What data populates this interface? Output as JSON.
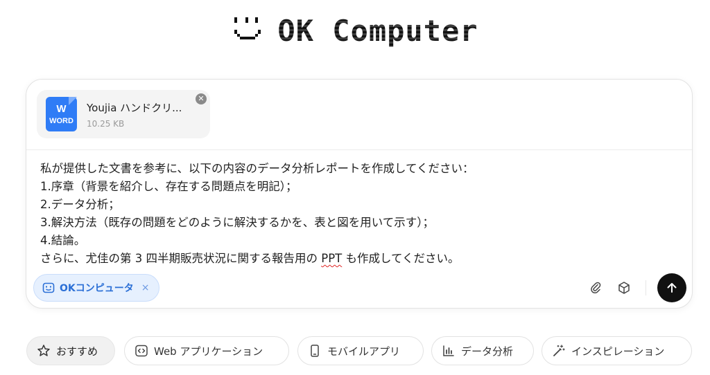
{
  "logo": {
    "text": "OK Computer"
  },
  "attachment": {
    "name": "Youjia ハンドクリ...",
    "size": "10.25 KB",
    "icon_label_top": "W",
    "icon_label_bottom": "WORD",
    "icon": "word-doc-icon",
    "close_icon": "close-icon"
  },
  "prompt": {
    "lines": [
      "私が提供した文書を参考に、以下の内容のデータ分析レポートを作成してください：",
      "1.序章（背景を紹介し、存在する問題点を明記）；",
      "2.データ分析；",
      "3.解決方法（既存の問題をどのように解決するかを、表と図を用いて示す）；",
      "4.結論。"
    ],
    "last_line_before": "さらに、尤佳の第 3 四半期販売状況に関する報告用の ",
    "last_line_misspelled": "PPT",
    "last_line_after": " も作成してください。"
  },
  "mode_chip": {
    "label": "OKコンピュータ",
    "close": "×",
    "icon": "robot-face-icon"
  },
  "toolbar": {
    "attach_icon": "paperclip-icon",
    "cube_icon": "cube-icon",
    "send_icon": "arrow-up-icon"
  },
  "suggestions": [
    {
      "label": "おすすめ",
      "icon": "star-icon",
      "active": true
    },
    {
      "label": "Web アプリケーション",
      "icon": "code-icon",
      "active": false
    },
    {
      "label": "モバイルアプリ",
      "icon": "phone-icon",
      "active": false
    },
    {
      "label": "データ分析",
      "icon": "bar-chart-icon",
      "active": false
    },
    {
      "label": "インスピレーション",
      "icon": "magic-wand-icon",
      "active": false
    }
  ],
  "colors": {
    "accent": "#2b6fd6",
    "chip_bg": "#e6f0fe",
    "word_blue": "#2f7cf6",
    "send_bg": "#111111"
  }
}
